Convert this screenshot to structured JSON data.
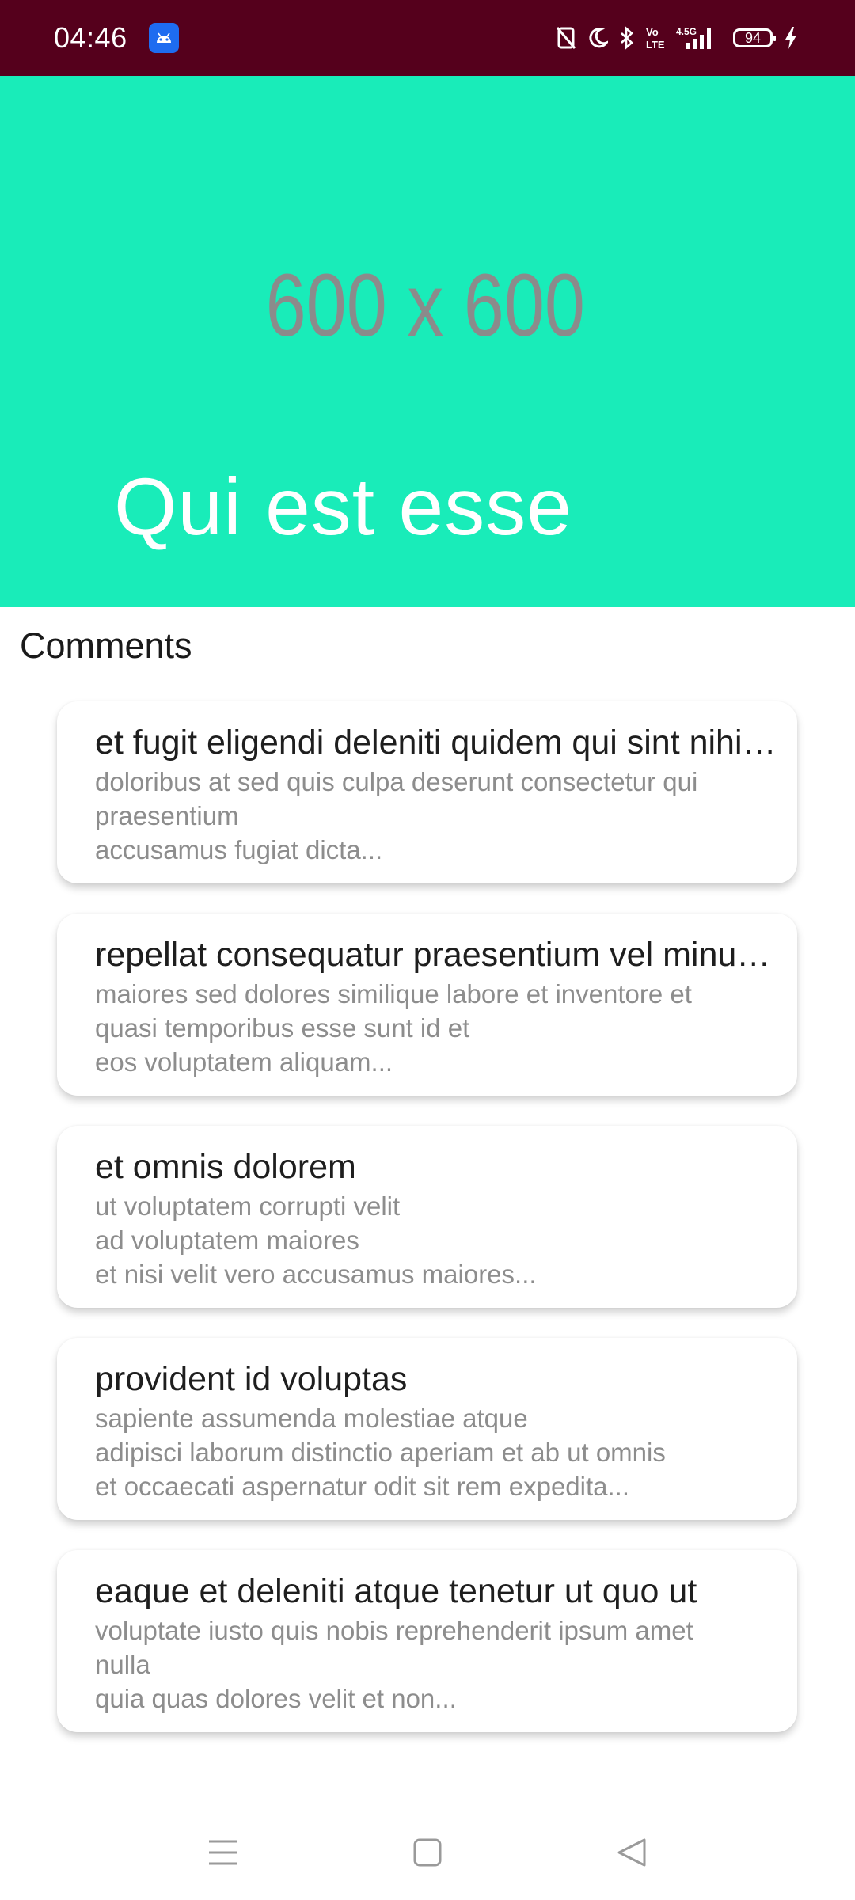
{
  "status_bar": {
    "time": "04:46",
    "battery_level": "94",
    "icons": [
      "android-app-icon",
      "nfc-off-icon",
      "moon-icon",
      "bluetooth-icon",
      "volte-icon",
      "signal-4g-icon",
      "battery-icon",
      "charging-icon"
    ]
  },
  "hero": {
    "placeholder_text": "600 x 600",
    "title": "Qui est esse",
    "background_color": "#19ecb9"
  },
  "comments_section": {
    "heading": "Comments",
    "items": [
      {
        "title": "et fugit eligendi deleniti quidem qui sint nihil autem",
        "body": "doloribus at sed quis culpa deserunt consectetur qui\npraesentium\naccusamus fugiat dicta..."
      },
      {
        "title": "repellat consequatur praesentium vel minus molestias voluptatum",
        "body": "maiores sed dolores similique labore et inventore et\nquasi temporibus esse sunt id et\neos voluptatem aliquam..."
      },
      {
        "title": "et omnis dolorem",
        "body": "ut voluptatem corrupti velit\nad voluptatem maiores\net nisi velit vero accusamus maiores..."
      },
      {
        "title": "provident id voluptas",
        "body": "sapiente assumenda molestiae atque\nadipisci laborum distinctio aperiam et ab ut omnis\net occaecati aspernatur odit sit rem expedita..."
      },
      {
        "title": "eaque et deleniti atque tenetur ut quo ut",
        "body": "voluptate iusto quis nobis reprehenderit ipsum amet\nnulla\nquia quas dolores velit et non..."
      }
    ]
  },
  "nav_bar": {
    "buttons": [
      "menu-icon",
      "home-square-icon",
      "back-triangle-icon"
    ]
  }
}
